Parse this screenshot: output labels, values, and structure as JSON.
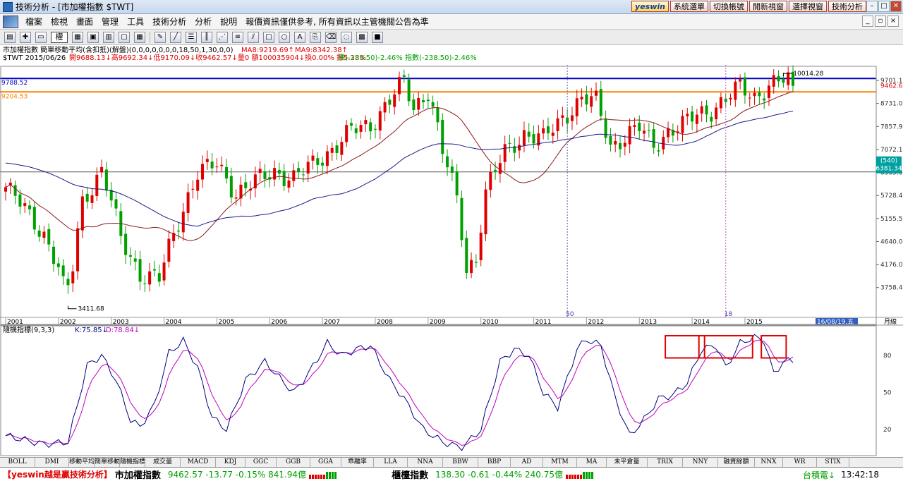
{
  "window": {
    "title": "技術分析 - [市加權指數 $TWT]"
  },
  "top_buttons": [
    "yeswin",
    "系統選單",
    "切換帳號",
    "開新視窗",
    "選擇視窗",
    "技術分析"
  ],
  "menu": [
    "檔案",
    "檢視",
    "畫面",
    "管理",
    "工具",
    "技術分析",
    "分析",
    "說明",
    "報價資訊僅供參考, 所有資訊以主管機關公告為準"
  ],
  "toolbar": {
    "weight_label": "權"
  },
  "chart_info": {
    "line1": "市加權指數 簡單移動平均(含扣抵)(解盤)(0,0,0,0,0,0,0,18,50,1,30,0,0)",
    "ma_a": "MA8:9219.69↑",
    "ma_b": "MA9:8342.38↑",
    "line2_date": "$TWT 2015/06/26",
    "line2_ohlc": "開9688.13↓高9692.34↓低9170.09↓收9462.57↓量0 額100035904↓換0.00% 振5.38%",
    "line2_chg": "漲(-238.50)-2.46% 指數(-238.50)-2.46%"
  },
  "price_axis": {
    "ticks": [
      "9701.1",
      "8731.0",
      "7857.9",
      "7072.1",
      "6365.0",
      "5728.4",
      "5155.5",
      "4640.0",
      "4176.0",
      "3758.4"
    ],
    "last_price": "9462.6",
    "cursor_tag": "(540)",
    "cursor_price": "6381.34"
  },
  "price_lines": {
    "blue_label": "9788.52",
    "orange_label": "9204.53"
  },
  "annotations": {
    "high": "10014.28",
    "low": "3411.68",
    "marker_a": "50",
    "marker_b": "18"
  },
  "year_axis": [
    "2001",
    "2002",
    "2003",
    "2004",
    "2005",
    "2006",
    "2007",
    "2008",
    "2009",
    "2010",
    "2011",
    "2012",
    "2013",
    "2014",
    "2015"
  ],
  "date_tag": "16/08/19,五",
  "period_label": "月線",
  "indicator": {
    "label": "隨機指標(9,3,3)",
    "k": "K:75.85↓",
    "d": "D:78.84↓",
    "ticks": [
      "80",
      "50",
      "20"
    ]
  },
  "bottom_tabs": [
    "BOLL",
    "DMI",
    "移動平均收",
    "簡單移動平",
    "隨機指標",
    "成交量",
    "MACD",
    "KDJ",
    "GGC",
    "GGB",
    "GGA",
    "乖離率",
    "LLA",
    "NNA",
    "BBW",
    "BBP",
    "AD",
    "MTM",
    "MA",
    "未平倉量",
    "TRIX",
    "NNY",
    "融資餘額",
    "NNX",
    "WR",
    "STIX"
  ],
  "status": {
    "promo": "【yeswin越是贏技術分析】",
    "idx1_name": "市加權指數",
    "idx1_vals": "9462.57 -13.77 -0.15% 841.94億",
    "idx2_name": "櫃檯指數",
    "idx2_vals": "138.30 -0.61 -0.44% 240.75億",
    "stock": "台積電↓",
    "time": "13:42:18"
  },
  "colors": {
    "up": "#e00000",
    "down": "#00a000",
    "ma_short": "#8b1a1a",
    "ma_long": "#1a1a8b",
    "blue_line": "#0000c0",
    "orange_line": "#ff8000",
    "k_line": "#000080",
    "d_line": "#c000c0",
    "box": "#e00000"
  },
  "chart_data": {
    "type": "candlestick",
    "title": "市加權指數",
    "x": [
      "2001",
      "2002",
      "2003",
      "2004",
      "2005",
      "2006",
      "2007",
      "2008",
      "2009",
      "2010",
      "2011",
      "2012",
      "2013",
      "2014",
      "2015"
    ],
    "close": [
      3900,
      5500,
      5600,
      6000,
      6500,
      7800,
      8500,
      4600,
      7700,
      8900,
      7200,
      7700,
      8600,
      9300,
      9462.57
    ],
    "ma_short_approx": [
      5000,
      4800,
      4900,
      5800,
      6100,
      6700,
      8000,
      7200,
      6000,
      8000,
      8300,
      7600,
      8000,
      8900,
      9200
    ],
    "ma_long_approx": [
      6300,
      5600,
      4900,
      5000,
      5300,
      6000,
      6800,
      7100,
      7100,
      7600,
      7800,
      7700,
      7800,
      8100,
      8500
    ],
    "kd_k_approx": [
      15,
      75,
      20,
      92,
      25,
      70,
      88,
      45,
      10,
      90,
      88,
      10,
      45,
      90,
      75
    ],
    "kd_d_approx": [
      20,
      60,
      25,
      80,
      35,
      60,
      80,
      50,
      20,
      80,
      85,
      18,
      40,
      85,
      79
    ],
    "ylim": [
      3411.68,
      10014.28
    ]
  }
}
